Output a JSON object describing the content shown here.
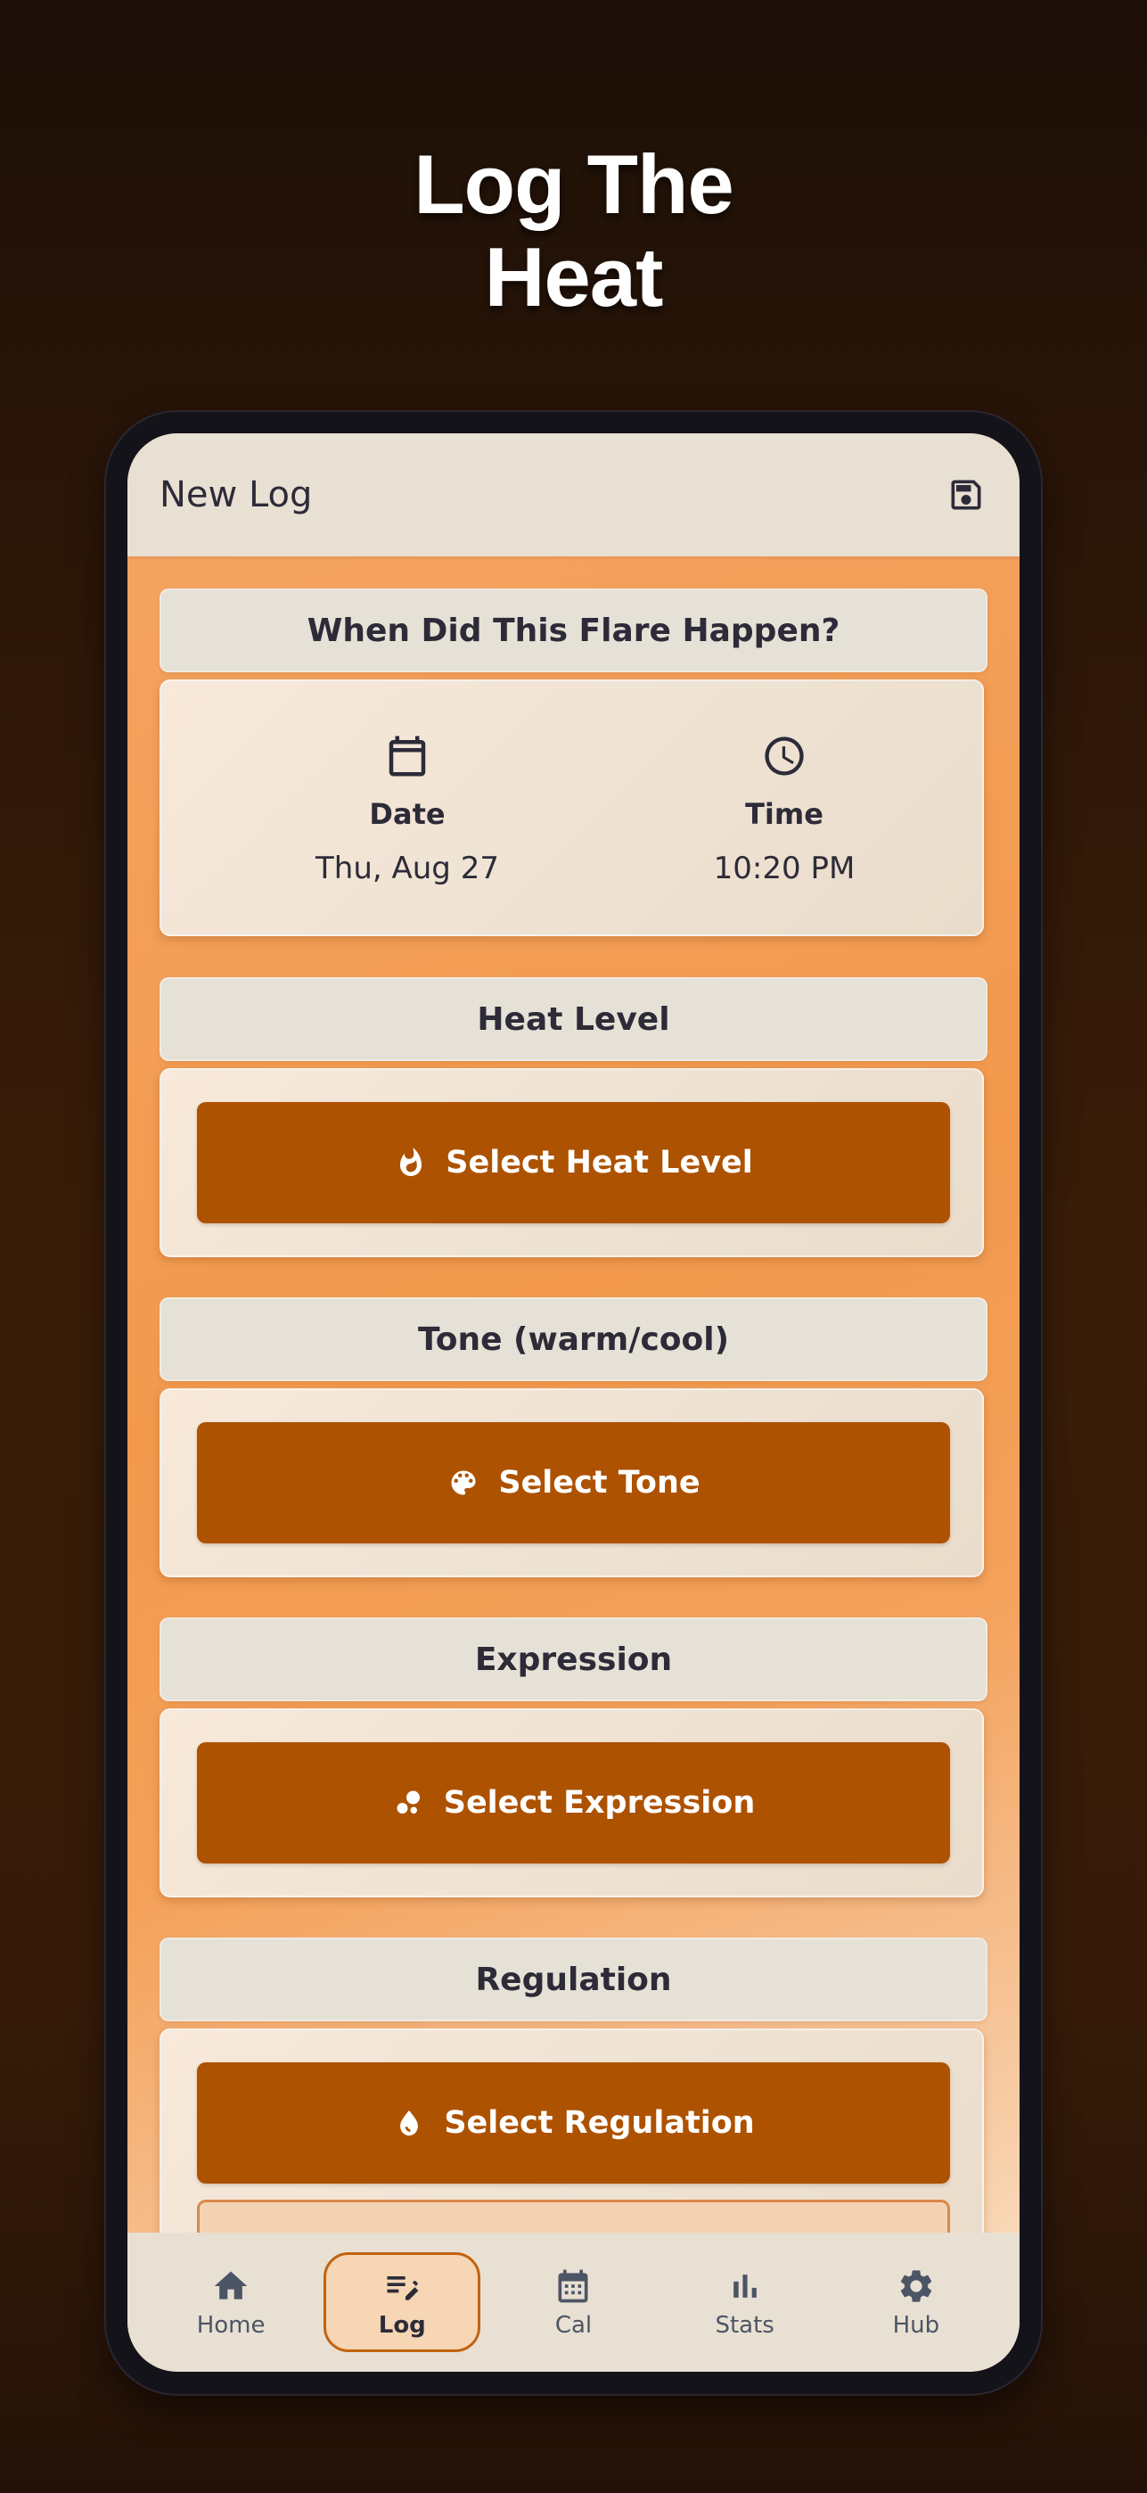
{
  "promo": {
    "title_line1": "Log The",
    "title_line2": "Heat"
  },
  "appbar": {
    "title": "New Log",
    "save_icon": "save-icon"
  },
  "sections": {
    "when": {
      "header": "When Did This Flare Happen?"
    },
    "date": {
      "label": "Date",
      "value": "Thu, Aug 27",
      "icon": "calendar-icon"
    },
    "time": {
      "label": "Time",
      "value": "10:20 PM",
      "icon": "clock-icon"
    },
    "heat": {
      "header": "Heat Level",
      "button": "Select Heat Level",
      "icon": "flame-icon"
    },
    "tone": {
      "header": "Tone (warm/cool)",
      "button": "Select Tone",
      "icon": "palette-icon"
    },
    "expression": {
      "header": "Expression",
      "button": "Select Expression",
      "icon": "bubbles-icon"
    },
    "regulation": {
      "header": "Regulation",
      "button": "Select Regulation",
      "icon": "drop-icon"
    }
  },
  "nav": {
    "items": [
      {
        "label": "Home",
        "icon": "home-icon",
        "active": false
      },
      {
        "label": "Log",
        "icon": "edit-note-icon",
        "active": true
      },
      {
        "label": "Cal",
        "icon": "calendar-icon",
        "active": false
      },
      {
        "label": "Stats",
        "icon": "bar-chart-icon",
        "active": false
      },
      {
        "label": "Hub",
        "icon": "gear-icon",
        "active": false
      }
    ]
  },
  "colors": {
    "accent": "#ad5200",
    "appbar": "#e8e0d2",
    "text": "#2d2b38",
    "nav_active_bg": "#f6d6b4",
    "nav_active_border": "#c2620f"
  }
}
